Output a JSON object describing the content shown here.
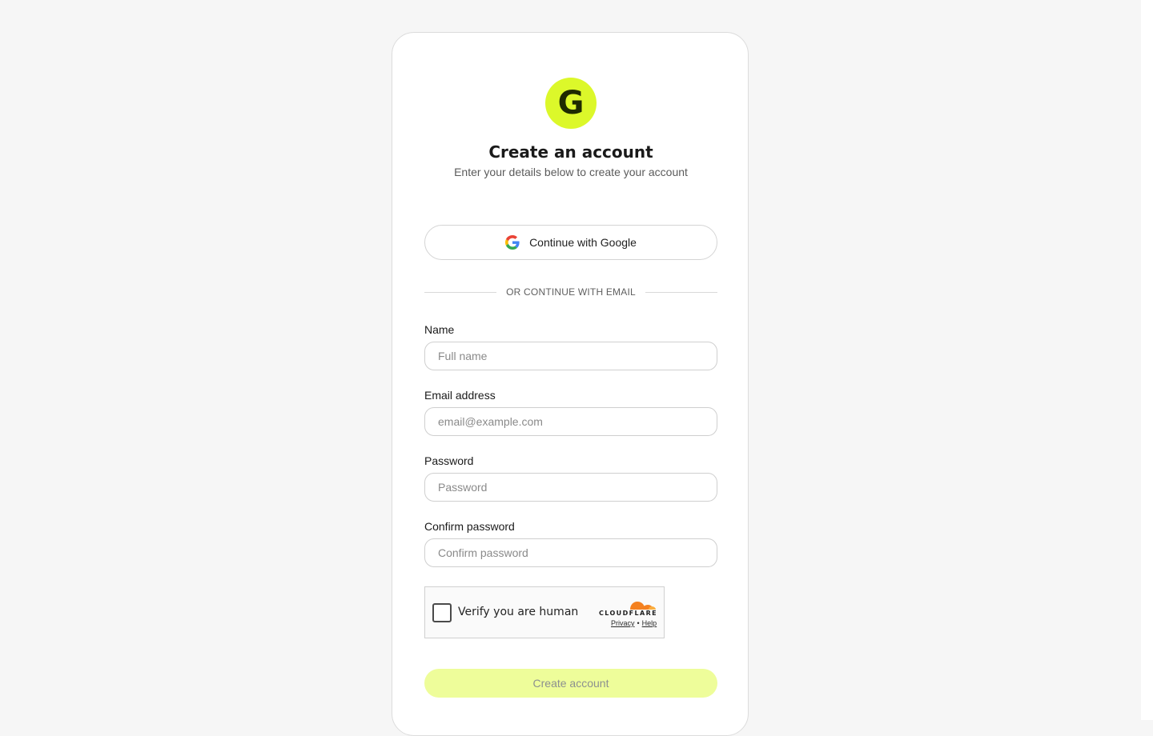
{
  "brand": {
    "logo_letter": "G",
    "accent_color": "#dcf82a",
    "button_disabled_color": "#eefd9a"
  },
  "header": {
    "title": "Create an account",
    "subtitle": "Enter your details below to create your account"
  },
  "oauth": {
    "google_label": "Continue with Google",
    "icon": "google-g-icon"
  },
  "divider": {
    "text": "OR CONTINUE WITH EMAIL"
  },
  "form": {
    "name": {
      "label": "Name",
      "placeholder": "Full name",
      "value": ""
    },
    "email": {
      "label": "Email address",
      "placeholder": "email@example.com",
      "value": ""
    },
    "password": {
      "label": "Password",
      "placeholder": "Password",
      "value": ""
    },
    "confirm_password": {
      "label": "Confirm password",
      "placeholder": "Confirm password",
      "value": ""
    },
    "submit_label": "Create account"
  },
  "captcha": {
    "label": "Verify you are human",
    "checked": false,
    "provider": "CLOUDFLARE",
    "privacy_label": "Privacy",
    "separator": "•",
    "help_label": "Help",
    "icon": "cloudflare-cloud-icon"
  }
}
